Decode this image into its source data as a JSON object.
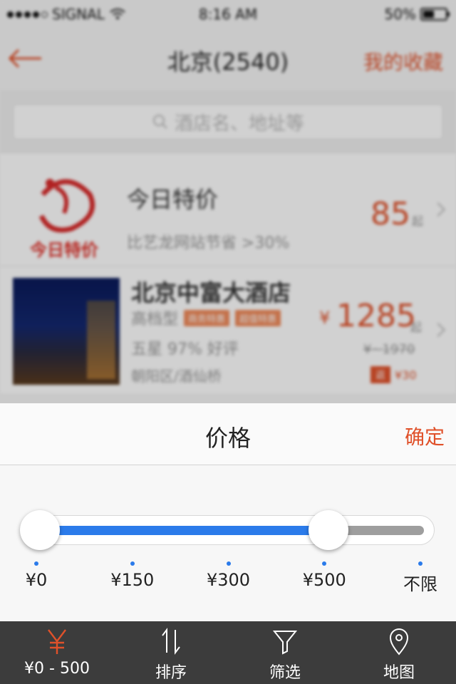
{
  "status_bar": {
    "carrier": "SIGNAL",
    "time": "8:16 AM",
    "battery": "50%"
  },
  "nav": {
    "title": "北京(2540)",
    "favorites_label": "我的收藏"
  },
  "search": {
    "placeholder": "酒店名、地址等"
  },
  "promo": {
    "logo_text": "今日特价",
    "title": "今日特价",
    "subtitle": "比艺龙网站节省 >30%",
    "price": "85",
    "unit": "起"
  },
  "hotel": {
    "name": "北京中富大酒店",
    "tags": [
      "高档型",
      "商务特惠",
      "超值特惠"
    ],
    "rating": "五星 97% 好评",
    "location": "朝阳区/酒仙桥",
    "currency": "¥",
    "price": "1285",
    "unit": "起",
    "original_price": "¥~1970",
    "cashback_badge": "返",
    "cashback": "¥30"
  },
  "price_sheet": {
    "title": "价格",
    "confirm_label": "确定",
    "range_low_fraction": 0.0,
    "range_high_fraction": 0.75,
    "ticks": [
      "¥0",
      "¥150",
      "¥300",
      "¥500",
      "不限"
    ],
    "accent_color": "#2b7bea"
  },
  "tabbar": {
    "tabs": [
      {
        "label": "¥0 - 500",
        "icon": "yen-icon",
        "active": true
      },
      {
        "label": "排序",
        "icon": "sort-icon",
        "active": false
      },
      {
        "label": "筛选",
        "icon": "filter-icon",
        "active": false
      },
      {
        "label": "地图",
        "icon": "map-pin-icon",
        "active": false
      }
    ],
    "active_color": "#e0512a"
  }
}
